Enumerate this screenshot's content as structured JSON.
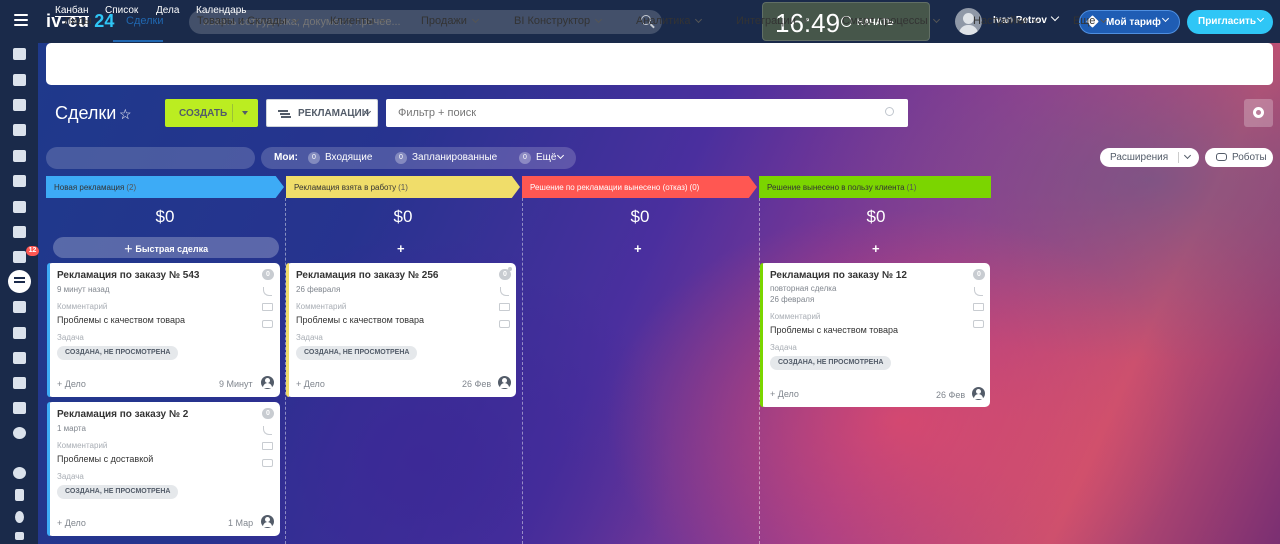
{
  "app": {
    "logo_main": "iv-eu",
    "logo_num": "24"
  },
  "search": {
    "placeholder": "искать сотрудника, документ, прочее..."
  },
  "clock": {
    "time": "16:49",
    "start": "НАЧАТЬ"
  },
  "user": {
    "name": "Ivan Petrov"
  },
  "tarif": {
    "label": "Мой тариф"
  },
  "invite": {
    "label": "Пригласить"
  },
  "sidebar": {
    "badge": "12"
  },
  "nav": {
    "items": [
      {
        "label": "Лиды",
        "active": false
      },
      {
        "label": "Сделки",
        "active": true
      },
      {
        "label": "Товары и Склады",
        "chevron": true
      },
      {
        "label": "Клиенты",
        "chevron": true
      },
      {
        "label": "Продажи",
        "chevron": true
      },
      {
        "label": "BI Конструктор",
        "chevron": true
      },
      {
        "label": "Аналитика",
        "chevron": true
      },
      {
        "label": "Интеграции",
        "chevron": true
      },
      {
        "label": "Смарт-процессы",
        "chevron": true
      },
      {
        "label": "Настройки",
        "chevron": true
      },
      {
        "label": "Еще",
        "chevron": true
      }
    ]
  },
  "page": {
    "title": "Сделки"
  },
  "toolbar": {
    "create_label": "СОЗДАТЬ",
    "category_label": "РЕКЛАМАЦИИ",
    "filter_placeholder": "Фильтр + поиск"
  },
  "views": {
    "kanban": "Канбан",
    "list": "Список",
    "activities": "Дела",
    "calendar": "Календарь"
  },
  "mine": {
    "label": "Мои:",
    "incoming_count": "0",
    "incoming": "Входящие",
    "planned_count": "0",
    "planned": "Запланированные",
    "more_count": "0",
    "more": "Ещё"
  },
  "extensions": {
    "label": "Расширения"
  },
  "robots": {
    "label": "Роботы"
  },
  "quick_deal": "Быстрая сделка",
  "stages": [
    {
      "name": "Новая рекламация",
      "count": "(2)",
      "sum": "$0",
      "color": "#3dabf6"
    },
    {
      "name": "Рекламация взята в работу",
      "count": "(1)",
      "sum": "$0",
      "color": "#f0dd6a"
    },
    {
      "name": "Решение по рекламации вынесено (отказ)",
      "count": "(0)",
      "sum": "$0",
      "color": "#ff5752"
    },
    {
      "name": "Решение вынесено в пользу клиента",
      "count": "(1)",
      "sum": "$0",
      "color": "#7bd500"
    }
  ],
  "cards": [
    {
      "title": "Рекламация по заказу № 543",
      "date_line": "9 минут назад",
      "comment_label": "Комментарий",
      "comment": "Проблемы с качеством товара",
      "task_label": "Задача",
      "task_status": "СОЗДАНА, НЕ ПРОСМОТРЕНА",
      "add": "+ Дело",
      "date": "9 Минут",
      "counter": "0"
    },
    {
      "title": "Рекламация по заказу № 2",
      "date_line": "1 марта",
      "comment_label": "Комментарий",
      "comment": "Проблемы с доставкой",
      "task_label": "Задача",
      "task_status": "СОЗДАНА, НЕ ПРОСМОТРЕНА",
      "add": "+ Дело",
      "date": "1 Мар",
      "counter": "0"
    },
    {
      "title": "Рекламация по заказу № 256",
      "date_line": "26 февраля",
      "comment_label": "Комментарий",
      "comment": "Проблемы с качеством товара",
      "task_label": "Задача",
      "task_status": "СОЗДАНА, НЕ ПРОСМОТРЕНА",
      "add": "+ Дело",
      "date": "26 Фев",
      "counter": "0"
    },
    {
      "title": "Рекламация по заказу № 12",
      "extra": "повторная сделка",
      "date_line": "26 февраля",
      "comment_label": "Комментарий",
      "comment": "Проблемы с качеством товара",
      "task_label": "Задача",
      "task_status": "СОЗДАНА, НЕ ПРОСМОТРЕНА",
      "add": "+ Дело",
      "date": "26 Фев",
      "counter": "0"
    }
  ]
}
